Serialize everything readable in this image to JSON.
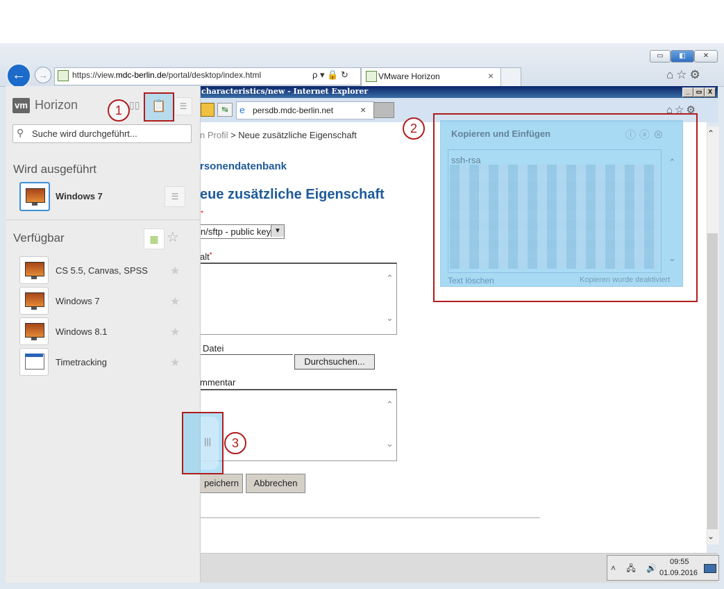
{
  "outer_browser": {
    "url_prefix": "https://view.",
    "url_host": "mdc-berlin.de",
    "url_path": "/portal/desktop/index.html",
    "url_tools": "ρ ▾ 🔒 ↻",
    "tab_label": "VMware Horizon",
    "tab_close": "×",
    "window_buttons": [
      "▭",
      "◧",
      "✕"
    ],
    "toolbar_icons": "⌂☆⚙"
  },
  "inner_browser": {
    "title": "characteristics/new - Internet Explorer",
    "window_buttons": [
      "_",
      "▭",
      "X"
    ],
    "tab_label": "persdb.mdc-berlin.net",
    "tab_close": "×",
    "toolbar_icons": "⌂☆⚙"
  },
  "page": {
    "breadcrumb_link": "n Profil",
    "breadcrumb_rest": " > Neue zusätzliche Eigenschaft",
    "db_title": "rsonendatenbank",
    "heading": "eue zusätzliche Eigenschaft",
    "select_value": "n/sftp - public key",
    "label_inhalt": "alt",
    "label_datei": "Datei",
    "browse_button": "Durchsuchen...",
    "label_kommentar": "mmentar",
    "save_button": "peichern",
    "cancel_button": "Abbrechen",
    "required_mark": "*"
  },
  "taskbar": {
    "time": "09:55",
    "date": "01.09.2016",
    "tray_icons": "˄ 🖧 🔊"
  },
  "sidebar": {
    "logo": "vm",
    "brand": "Horizon",
    "search_placeholder": "Suche wird durchgeführt...",
    "running_title": "Wird ausgeführt",
    "running_items": [
      {
        "label": "Windows 7"
      }
    ],
    "available_title": "Verfügbar",
    "available_items": [
      {
        "label": "CS 5.5, Canvas, SPSS"
      },
      {
        "label": "Windows 7"
      },
      {
        "label": "Windows 8.1"
      },
      {
        "label": "Timetracking"
      }
    ]
  },
  "copy_paste": {
    "title": "Kopieren und Einfügen",
    "content_start": "ssh-rsa",
    "clear_text": "Text löschen",
    "status": "Kopieren wurde deaktiviert"
  },
  "callouts": [
    "1",
    "2",
    "3"
  ],
  "colors": {
    "accent_red": "#b01c1c",
    "heading_blue": "#1d5a99",
    "highlight_blue": "#8ccdf0"
  }
}
